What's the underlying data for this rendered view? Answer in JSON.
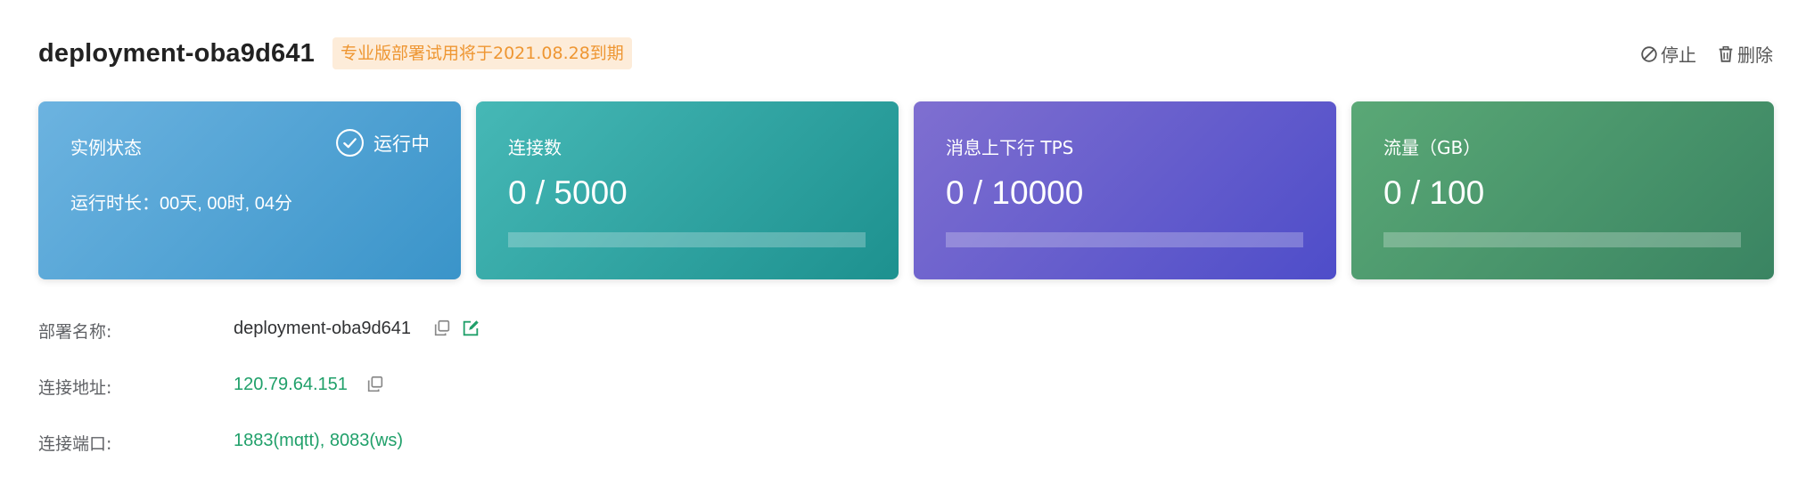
{
  "header": {
    "title": "deployment-oba9d641",
    "trial_badge": "专业版部署试用将于2021.08.28到期",
    "stop_label": "停止",
    "delete_label": "删除"
  },
  "cards": {
    "status": {
      "label": "实例状态",
      "state": "运行中",
      "runtime_label": "运行时长：",
      "runtime_value": "00天, 00时, 04分"
    },
    "connections": {
      "label": "连接数",
      "value": "0 / 5000",
      "progress": 0
    },
    "tps": {
      "label": "消息上下行 TPS",
      "value": "0 / 10000",
      "progress": 0
    },
    "traffic": {
      "label": "流量（GB）",
      "value": "0 / 100",
      "progress": 0
    }
  },
  "info": {
    "name_label": "部署名称:",
    "name_value": "deployment-oba9d641",
    "address_label": "连接地址:",
    "address_value": "120.79.64.151",
    "port_label": "连接端口:",
    "port_value": "1883(mqtt), 8083(ws)"
  },
  "colors": {
    "trial_badge_bg": "#fdecd9",
    "trial_badge_text": "#ee9632",
    "link_green": "#20a06a",
    "status_card": "#4fa3d6",
    "connections_card": "#2fa5a3",
    "tps_card": "#6560ce",
    "traffic_card": "#4a966c"
  },
  "icons": [
    "stop-icon",
    "trash-icon",
    "check-circle-icon",
    "copy-icon",
    "edit-icon"
  ]
}
